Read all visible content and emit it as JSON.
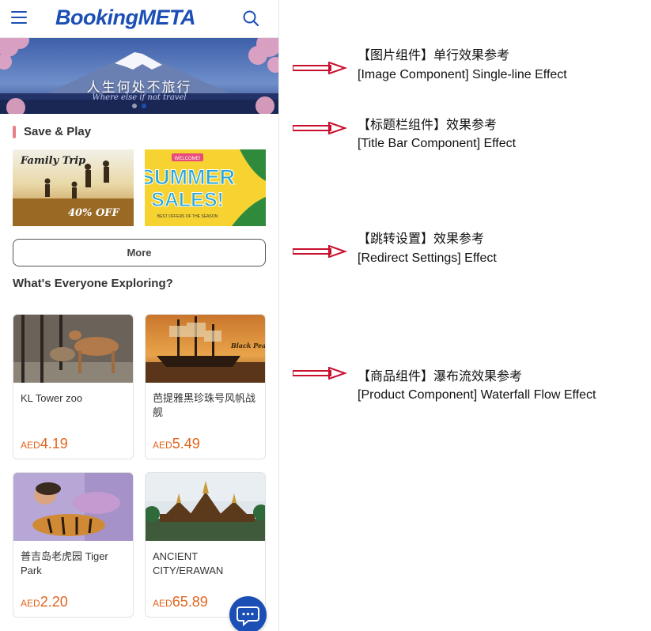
{
  "header": {
    "logo": "BookingMETA",
    "menu_icon": "hamburger-menu-icon",
    "search_icon": "search-icon",
    "brand_color": "#1b4fb6"
  },
  "banner": {
    "caption": "人生何处不旅行",
    "subcaption": "Where else if not travel",
    "slide_count": 4,
    "active_slide": 2
  },
  "save_play": {
    "title": "Save & Play",
    "accent_color": "#e67f86",
    "promos": [
      {
        "headline": "Family Trip",
        "badge": "40% OFF"
      },
      {
        "top": "WELCOME!",
        "headline": "SUMMER",
        "headline2": "SALES!",
        "footer": "BEST OFFERS OF THE SEASON"
      }
    ],
    "more_label": "More"
  },
  "explore": {
    "heading": "What's Everyone Exploring?",
    "products": [
      {
        "name": "KL Tower zoo",
        "currency": "AED",
        "price": "4.19"
      },
      {
        "name": "芭提雅黑珍珠号风帆战舰",
        "currency": "AED",
        "price": "5.49",
        "image_text": "Black Pearl"
      },
      {
        "name": "普吉岛老虎园 Tiger Park",
        "currency": "AED",
        "price": "2.20"
      },
      {
        "name": "ANCIENT CITY/ERAWAN",
        "currency": "AED",
        "price": "65.89"
      }
    ],
    "price_color": "#e0651e"
  },
  "chat": {
    "icon": "chat-bubble-icon"
  },
  "annotations": [
    {
      "zh": "【图片组件】单行效果参考",
      "en": " [Image Component] Single-line Effect"
    },
    {
      "zh": "【标题栏组件】效果参考",
      "en": "[Title Bar Component] Effect"
    },
    {
      "zh": "【跳转设置】效果参考",
      "en": "[Redirect Settings] Effect"
    },
    {
      "zh": "【商品组件】瀑布流效果参考",
      "en": "[Product Component] Waterfall Flow Effect"
    }
  ],
  "annotation_arrow_color": "#c8102e"
}
